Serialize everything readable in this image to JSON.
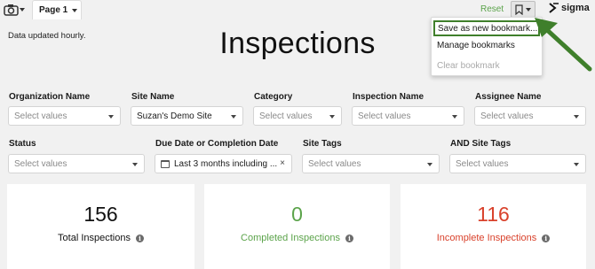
{
  "toolbar": {
    "page_tab_label": "Page 1",
    "reset_label": "Reset",
    "logo_text": "sigma",
    "camera_icon": "camera-icon",
    "bookmark_icon": "bookmark-icon"
  },
  "header": {
    "updated_text": "Data updated hourly.",
    "title": "Inspections"
  },
  "filters": {
    "organization_name": {
      "label": "Organization Name",
      "value": "Select values"
    },
    "site_name": {
      "label": "Site Name",
      "value": "Suzan's Demo Site"
    },
    "category": {
      "label": "Category",
      "value": "Select values"
    },
    "inspection_name": {
      "label": "Inspection Name",
      "value": "Select values"
    },
    "assignee_name": {
      "label": "Assignee Name",
      "value": "Select values"
    },
    "status": {
      "label": "Status",
      "value": "Select values"
    },
    "due_date": {
      "label": "Due Date or Completion Date",
      "value": "Last 3 months including ...",
      "clear": "×"
    },
    "site_tags": {
      "label": "Site Tags",
      "value": "Select values"
    },
    "and_site_tags": {
      "label": "AND Site Tags",
      "value": "Select values"
    }
  },
  "kpis": [
    {
      "value": "156",
      "label": "Total Inspections",
      "color": "#111111"
    },
    {
      "value": "0",
      "label": "Completed Inspections",
      "color": "#5ba34a"
    },
    {
      "value": "116",
      "label": "Incomplete Inspections",
      "color": "#d9412b"
    }
  ],
  "bookmark_menu": {
    "items": [
      {
        "label": "Save as new bookmark...",
        "highlighted": true
      },
      {
        "label": "Manage bookmarks"
      },
      {
        "label": "Clear bookmark",
        "disabled": true
      }
    ]
  },
  "colors": {
    "accent_green": "#5ba34a",
    "annotation_green": "#3f7f2b",
    "alert_red": "#d9412b"
  }
}
